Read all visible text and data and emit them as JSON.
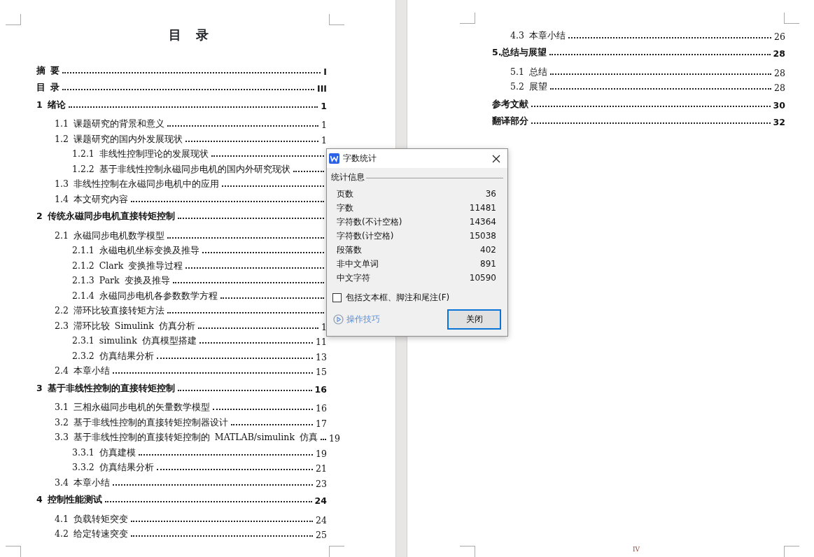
{
  "left_page": {
    "title": "目 录",
    "toc": [
      {
        "title": "摘 要",
        "page": "I"
      },
      {
        "title": "目 录",
        "page": "III"
      },
      {
        "title": "1 绪论",
        "page": "1",
        "children": [
          {
            "title": "1.1 课题研究的背景和意义",
            "page": "1"
          },
          {
            "title": "1.2 课题研究的国内外发展现状",
            "page": "1",
            "children": [
              {
                "title": "1.2.1 非线性控制理论的发展现状"
              },
              {
                "title": "1.2.2 基于非线性控制永磁同步电机的国内外研究现状"
              }
            ]
          },
          {
            "title": "1.3 非线性控制在永磁同步电机中的应用"
          },
          {
            "title": "1.4 本文研究内容"
          }
        ]
      },
      {
        "title": "2 传统永磁同步电机直接转矩控制",
        "children": [
          {
            "title": "2.1 永磁同步电机数学模型",
            "children": [
              {
                "title": "2.1.1 永磁电机坐标变换及推导"
              },
              {
                "title": "2.1.2 Clark 变换推导过程"
              },
              {
                "title": "2.1.3  Park 变换及推导"
              },
              {
                "title": "2.1.4 永磁同步电机各参数数学方程"
              }
            ]
          },
          {
            "title": "2.2 滞环比较直接转矩方法"
          },
          {
            "title": "2.3 滞环比较 Simulink 仿真分析",
            "page": "1",
            "children": [
              {
                "title": "2.3.1 simulink 仿真模型搭建",
                "page": "11"
              },
              {
                "title": "2.3.2 仿真结果分析",
                "page": "13"
              }
            ]
          },
          {
            "title": "2.4 本章小结",
            "page": "15"
          }
        ]
      },
      {
        "title": "3 基于非线性控制的直接转矩控制",
        "page": "16",
        "children": [
          {
            "title": "3.1 三相永磁同步电机的矢量数学模型",
            "page": "16"
          },
          {
            "title": "3.2 基于非线性控制的直接转矩控制器设计",
            "page": "17"
          },
          {
            "title": "3.3 基于非线性控制的直接转矩控制的 MATLAB/simulink 仿真",
            "page": "19",
            "children": [
              {
                "title": "3.3.1 仿真建模",
                "page": "19"
              },
              {
                "title": "3.3.2 仿真结果分析",
                "page": "21"
              }
            ]
          },
          {
            "title": "3.4 本章小结",
            "page": "23"
          }
        ]
      },
      {
        "title": "4 控制性能测试",
        "page": "24",
        "children": [
          {
            "title": "4.1 负载转矩突变",
            "page": "24"
          },
          {
            "title": "4.2 给定转速突变",
            "page": "25"
          }
        ]
      }
    ]
  },
  "right_page": {
    "toc_continued": [
      {
        "title": "4.3 本章小结",
        "page": "26"
      }
    ],
    "toc": [
      {
        "title": "5.总结与展望",
        "page": "28",
        "children": [
          {
            "title": "5.1 总结",
            "page": "28"
          },
          {
            "title": "5.2 展望",
            "page": "28"
          }
        ]
      },
      {
        "title": "参考文献",
        "page": "30"
      },
      {
        "title": "翻译部分",
        "page": "32"
      }
    ],
    "page_number": "IV"
  },
  "dialog": {
    "title": "字数统计",
    "group": "统计信息",
    "stats": [
      {
        "label": "页数",
        "value": "36"
      },
      {
        "label": "字数",
        "value": "11481"
      },
      {
        "label": "字符数(不计空格)",
        "value": "14364"
      },
      {
        "label": "字符数(计空格)",
        "value": "15038"
      },
      {
        "label": "段落数",
        "value": "402"
      },
      {
        "label": "非中文单词",
        "value": "891"
      },
      {
        "label": "中文字符",
        "value": "10590"
      }
    ],
    "checkbox": {
      "label": "包括文本框、脚注和尾注(F)",
      "checked": false
    },
    "tips_link": "操作技巧",
    "close_button": "关闭"
  }
}
